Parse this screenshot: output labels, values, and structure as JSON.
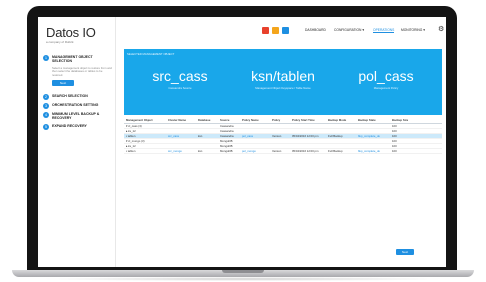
{
  "app": {
    "name": "Datos IO",
    "tagline": "a company of Rubrik"
  },
  "sidebar": {
    "steps": [
      {
        "num": "1",
        "label": "Management Object Selection",
        "desc": "Select a management object to restore from and then select the databases or tables to be restored."
      },
      {
        "num": "2",
        "label": "Search Selection",
        "desc": ""
      },
      {
        "num": "3",
        "label": "Orchestration Setting",
        "desc": ""
      },
      {
        "num": "4",
        "label": "Minimum Level Backup & Recovery",
        "desc": ""
      },
      {
        "num": "5",
        "label": "Expand Recovery",
        "desc": ""
      }
    ],
    "next_label": "Next"
  },
  "header": {
    "buttons": [
      {
        "color": "#e8412c"
      },
      {
        "color": "#f4a51c"
      },
      {
        "color": "#1e8fe1"
      }
    ],
    "nav": [
      "Dashboard",
      "Configuration ▾",
      "Operations",
      "Monitoring ▾"
    ],
    "active_nav": "Operations"
  },
  "banner": {
    "label": "Selected Management Object",
    "source": {
      "name": "src_cass",
      "sub": "Cassandra Source"
    },
    "object": {
      "name": "ksn/tablen",
      "sub": "Management Object Keyspace / Table Name"
    },
    "policy": {
      "name": "pol_cass",
      "sub": "Management Policy"
    }
  },
  "table": {
    "columns": [
      "Management Object",
      "Cluster Name",
      "Database",
      "Source",
      "Policy Name",
      "Policy",
      "Policy Start Time",
      "Backup Mode",
      "Backup State",
      "Backup Size"
    ],
    "rows": [
      {
        "cells": [
          "▾ cl_cass (3)",
          "",
          "",
          "Cassandra",
          "",
          "",
          "",
          "",
          "",
          "100"
        ],
        "selected": false
      },
      {
        "cells": [
          "   ▸ ks_12",
          "",
          "",
          "Cassandra",
          "",
          "",
          "",
          "",
          "",
          "100"
        ],
        "selected": false
      },
      {
        "cells": [
          "      ▪ tablen",
          "src_cass",
          "ksn",
          "Cassandra",
          "pol_cass",
          "Version",
          "05/04/2016 12:00 pm",
          "Full Backup",
          "bkp_complete_ok",
          "100"
        ],
        "selected": true
      },
      {
        "cells": [
          "▾ cl_mongo (3)",
          "",
          "",
          "MongoDB",
          "",
          "",
          "",
          "",
          "",
          "100"
        ],
        "selected": false
      },
      {
        "cells": [
          "   ▸ ks_12",
          "",
          "",
          "MongoDB",
          "",
          "",
          "",
          "",
          "",
          "100"
        ],
        "selected": false
      },
      {
        "cells": [
          "      ▪ tablen",
          "src_mongo",
          "ksn",
          "MongoDB",
          "pol_mongo",
          "Version",
          "05/04/2016 12:00 pm",
          "Full Backup",
          "bkp_complete_ok",
          "100"
        ],
        "selected": false
      }
    ]
  },
  "footer": {
    "next_label": "Next"
  }
}
